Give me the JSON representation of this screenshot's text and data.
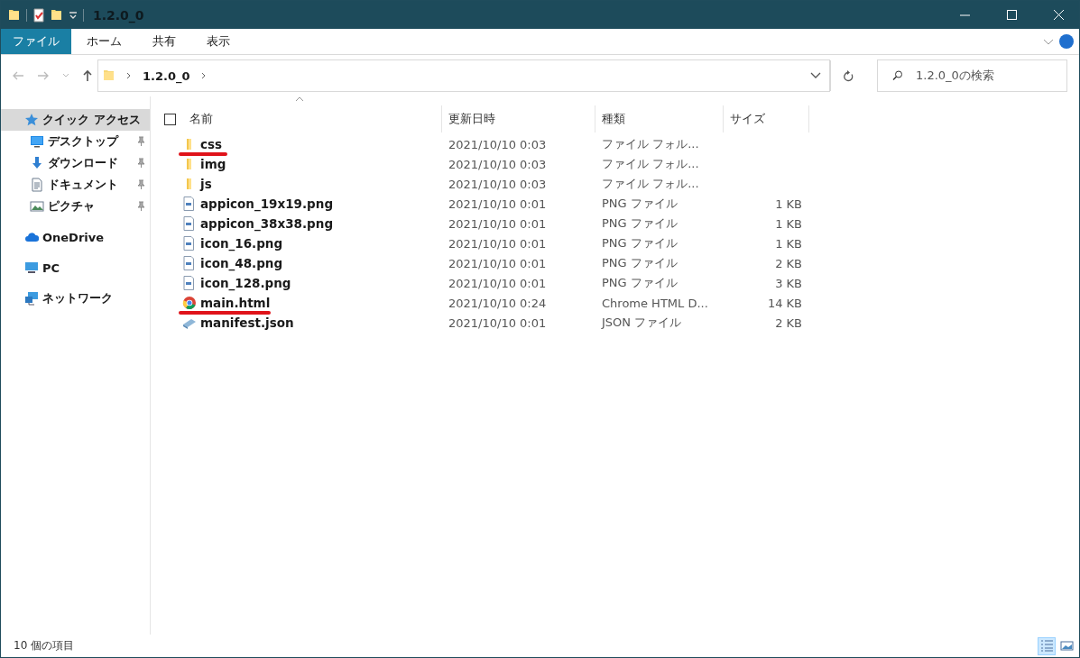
{
  "window": {
    "title": "1.2.0_0"
  },
  "ribbon": {
    "file_button": "ファイル",
    "tabs": [
      {
        "label": "ホーム",
        "selected": false
      },
      {
        "label": "共有",
        "selected": false
      },
      {
        "label": "表示",
        "selected": false
      }
    ]
  },
  "address": {
    "path": "1.2.0_0",
    "search_placeholder": "1.2.0_0の検索"
  },
  "sidebar": {
    "items": [
      {
        "label": "クイック アクセス",
        "kind": "star",
        "selected": true,
        "pinned": false,
        "children": [
          {
            "label": "デスクトップ",
            "kind": "desktop",
            "selected": false,
            "pinned": true
          },
          {
            "label": "ダウンロード",
            "kind": "download",
            "selected": false,
            "pinned": true
          },
          {
            "label": "ドキュメント",
            "kind": "document",
            "selected": false,
            "pinned": true
          },
          {
            "label": "ピクチャ",
            "kind": "picture",
            "selected": false,
            "pinned": true
          }
        ]
      },
      {
        "label": "OneDrive",
        "kind": "cloud",
        "selected": false,
        "pinned": false
      },
      {
        "label": "PC",
        "kind": "pc",
        "selected": false,
        "pinned": false
      },
      {
        "label": "ネットワーク",
        "kind": "network",
        "selected": false,
        "pinned": false
      }
    ]
  },
  "table": {
    "select_all": {
      "checked": false
    },
    "columns": [
      "名前",
      "更新日時",
      "種類",
      "サイズ"
    ],
    "rows": [
      {
        "kind": "folder",
        "name": "css",
        "date": "2021/10/10 0:03",
        "type": "ファイル フォル...",
        "size": "",
        "underlined": true
      },
      {
        "kind": "folder",
        "name": "img",
        "date": "2021/10/10 0:03",
        "type": "ファイル フォル...",
        "size": "",
        "underlined": false
      },
      {
        "kind": "folder",
        "name": "js",
        "date": "2021/10/10 0:03",
        "type": "ファイル フォル...",
        "size": "",
        "underlined": false
      },
      {
        "kind": "image",
        "name": "appicon_19x19.png",
        "date": "2021/10/10 0:01",
        "type": "PNG ファイル",
        "size": "1 KB",
        "underlined": false
      },
      {
        "kind": "image",
        "name": "appicon_38x38.png",
        "date": "2021/10/10 0:01",
        "type": "PNG ファイル",
        "size": "1 KB",
        "underlined": false
      },
      {
        "kind": "image",
        "name": "icon_16.png",
        "date": "2021/10/10 0:01",
        "type": "PNG ファイル",
        "size": "1 KB",
        "underlined": false
      },
      {
        "kind": "image",
        "name": "icon_48.png",
        "date": "2021/10/10 0:01",
        "type": "PNG ファイル",
        "size": "2 KB",
        "underlined": false
      },
      {
        "kind": "image",
        "name": "icon_128.png",
        "date": "2021/10/10 0:01",
        "type": "PNG ファイル",
        "size": "3 KB",
        "underlined": false
      },
      {
        "kind": "browser",
        "name": "main.html",
        "date": "2021/10/10 0:24",
        "type": "Chrome HTML D...",
        "size": "14 KB",
        "underlined": true
      },
      {
        "kind": "json",
        "name": "manifest.json",
        "date": "2021/10/10 0:01",
        "type": "JSON ファイル",
        "size": "2 KB",
        "underlined": false
      }
    ]
  },
  "status_bar": {
    "count": "10 個の項目",
    "views": [
      {
        "kind": "details",
        "selected": true
      },
      {
        "kind": "tiles",
        "selected": false
      }
    ]
  }
}
